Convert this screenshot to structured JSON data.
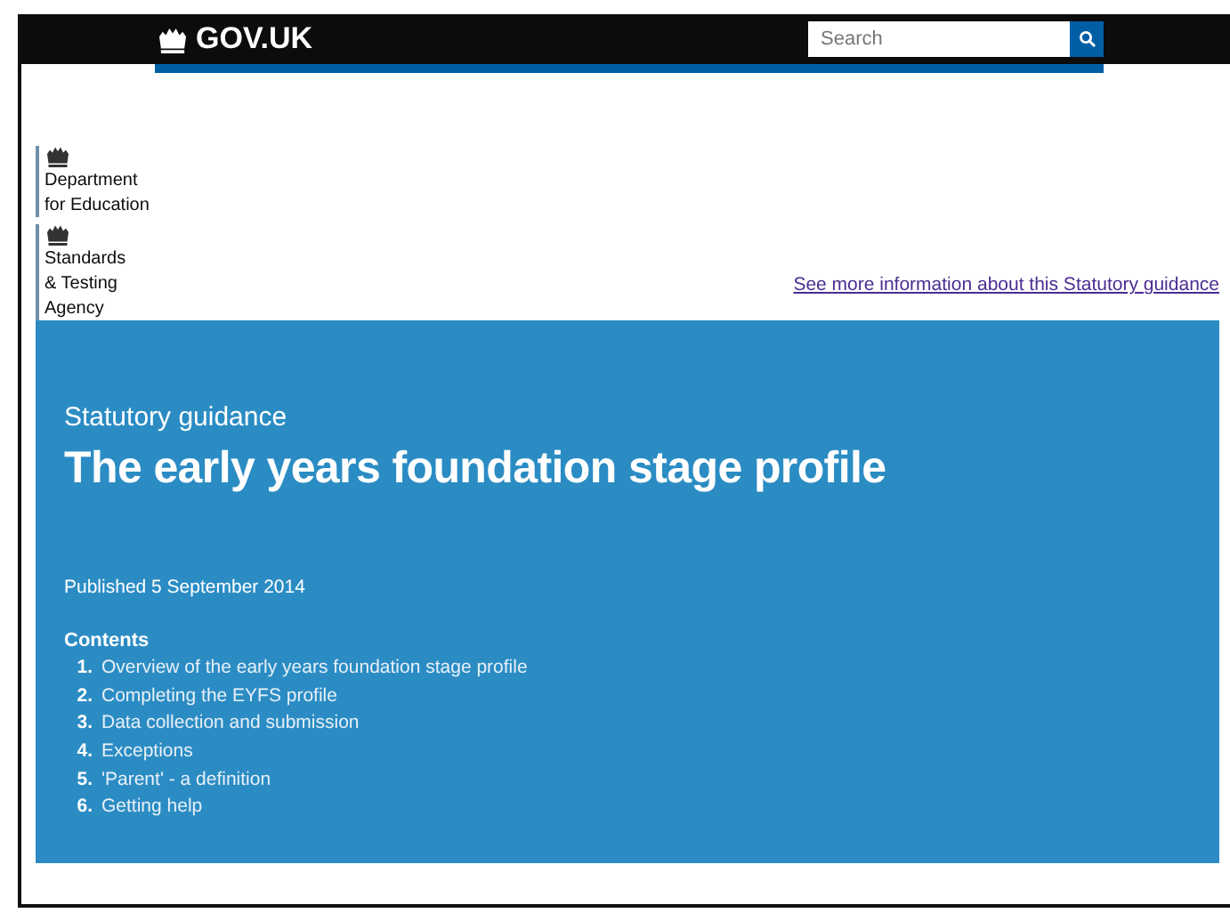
{
  "header": {
    "logo": "GOV.UK",
    "search": {
      "placeholder": "Search"
    }
  },
  "organisations": [
    {
      "lines": [
        "Department",
        "for Education"
      ]
    },
    {
      "lines": [
        "Standards",
        "& Testing",
        "Agency"
      ]
    }
  ],
  "more_info_link": "See more information about this Statutory guidance",
  "hero": {
    "kicker": "Statutory guidance",
    "title": "The early years foundation stage profile",
    "published": "Published 5 September 2014",
    "contents_heading": "Contents",
    "contents": [
      {
        "number": "1.",
        "label": "Overview of the early years foundation stage profile"
      },
      {
        "number": "2.",
        "label": "Completing the EYFS profile"
      },
      {
        "number": "3.",
        "label": "Data collection and submission"
      },
      {
        "number": "4.",
        "label": "Exceptions"
      },
      {
        "number": "5.",
        "label": "'Parent' - a definition"
      },
      {
        "number": "6.",
        "label": "Getting help"
      }
    ]
  }
}
